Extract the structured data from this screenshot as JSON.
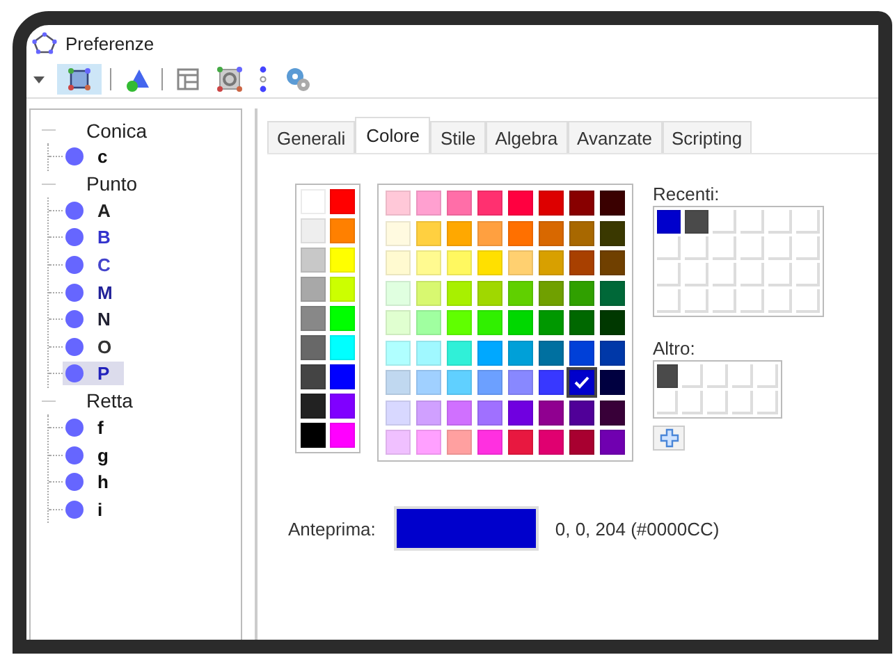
{
  "window": {
    "title": "Preferenze"
  },
  "toolbar": {
    "items": [
      {
        "kind": "dropdown",
        "selected": false
      },
      {
        "kind": "points",
        "selected": true
      },
      {
        "kind": "separator"
      },
      {
        "kind": "shapes",
        "selected": false
      },
      {
        "kind": "separator"
      },
      {
        "kind": "layout",
        "selected": false
      },
      {
        "kind": "graphics",
        "selected": false
      },
      {
        "kind": "dots",
        "selected": false
      },
      {
        "kind": "gears",
        "selected": false
      }
    ]
  },
  "tree": [
    {
      "label": "Conica",
      "expanded": true,
      "children": [
        {
          "label": "c",
          "color": "#111111",
          "selected": false
        }
      ]
    },
    {
      "label": "Punto",
      "expanded": true,
      "children": [
        {
          "label": "A",
          "color": "#222222",
          "selected": false
        },
        {
          "label": "B",
          "color": "#3333cc",
          "selected": false
        },
        {
          "label": "C",
          "color": "#4444cc",
          "selected": false
        },
        {
          "label": "M",
          "color": "#222299",
          "selected": false
        },
        {
          "label": "N",
          "color": "#222233",
          "selected": false
        },
        {
          "label": "O",
          "color": "#333333",
          "selected": false
        },
        {
          "label": "P",
          "color": "#2222bb",
          "selected": true
        }
      ]
    },
    {
      "label": "Retta",
      "expanded": true,
      "children": [
        {
          "label": "f",
          "color": "#111111",
          "selected": false
        },
        {
          "label": "g",
          "color": "#111111",
          "selected": false
        },
        {
          "label": "h",
          "color": "#111111",
          "selected": false
        },
        {
          "label": "i",
          "color": "#111111",
          "selected": false
        }
      ]
    }
  ],
  "tabs": [
    {
      "label": "Generali",
      "selected": false
    },
    {
      "label": "Colore",
      "selected": true
    },
    {
      "label": "Stile",
      "selected": false
    },
    {
      "label": "Algebra",
      "selected": false
    },
    {
      "label": "Avanzate",
      "selected": false
    },
    {
      "label": "Scripting",
      "selected": false
    }
  ],
  "gray_palette": [
    [
      {
        "color": "#ffffff",
        "selected": false
      },
      {
        "color": "#ff0000",
        "selected": false
      }
    ],
    [
      {
        "color": "#eeeeee",
        "selected": false
      },
      {
        "color": "#ff8000",
        "selected": false
      }
    ],
    [
      {
        "color": "#c8c8c8",
        "selected": false
      },
      {
        "color": "#ffff00",
        "selected": false
      }
    ],
    [
      {
        "color": "#a8a8a8",
        "selected": false
      },
      {
        "color": "#ccff00",
        "selected": false
      }
    ],
    [
      {
        "color": "#888888",
        "selected": false
      },
      {
        "color": "#00ff00",
        "selected": false
      }
    ],
    [
      {
        "color": "#686868",
        "selected": false
      },
      {
        "color": "#00ffff",
        "selected": false
      }
    ],
    [
      {
        "color": "#444444",
        "selected": false
      },
      {
        "color": "#0000ff",
        "selected": false
      }
    ],
    [
      {
        "color": "#222222",
        "selected": false
      },
      {
        "color": "#8000ff",
        "selected": false
      }
    ],
    [
      {
        "color": "#000000",
        "selected": false
      },
      {
        "color": "#ff00ff",
        "selected": false
      }
    ]
  ],
  "palette": [
    [
      {
        "color": "#ffc8d8",
        "selected": false
      },
      {
        "color": "#ffa0d0",
        "selected": false
      },
      {
        "color": "#ff6ea8",
        "selected": false
      },
      {
        "color": "#ff3070",
        "selected": false
      },
      {
        "color": "#ff0040",
        "selected": false
      },
      {
        "color": "#dd0000",
        "selected": false
      },
      {
        "color": "#880000",
        "selected": false
      },
      {
        "color": "#3a0000",
        "selected": false
      }
    ],
    [
      {
        "color": "#fffae0",
        "selected": false
      },
      {
        "color": "#ffd040",
        "selected": false
      },
      {
        "color": "#ffa800",
        "selected": false
      },
      {
        "color": "#ffa040",
        "selected": false
      },
      {
        "color": "#ff7000",
        "selected": false
      },
      {
        "color": "#d86800",
        "selected": false
      },
      {
        "color": "#a86800",
        "selected": false
      },
      {
        "color": "#3a3800",
        "selected": false
      }
    ],
    [
      {
        "color": "#fffad0",
        "selected": false
      },
      {
        "color": "#fffa90",
        "selected": false
      },
      {
        "color": "#fff860",
        "selected": false
      },
      {
        "color": "#ffe000",
        "selected": false
      },
      {
        "color": "#ffd070",
        "selected": false
      },
      {
        "color": "#d8a000",
        "selected": false
      },
      {
        "color": "#a84000",
        "selected": false
      },
      {
        "color": "#704000",
        "selected": false
      }
    ],
    [
      {
        "color": "#e0ffe0",
        "selected": false
      },
      {
        "color": "#d8f870",
        "selected": false
      },
      {
        "color": "#a8f000",
        "selected": false
      },
      {
        "color": "#a0d800",
        "selected": false
      },
      {
        "color": "#60d000",
        "selected": false
      },
      {
        "color": "#70a000",
        "selected": false
      },
      {
        "color": "#30a000",
        "selected": false
      },
      {
        "color": "#006838",
        "selected": false
      }
    ],
    [
      {
        "color": "#e0ffd0",
        "selected": false
      },
      {
        "color": "#a0ffa0",
        "selected": false
      },
      {
        "color": "#60ff00",
        "selected": false
      },
      {
        "color": "#30f000",
        "selected": false
      },
      {
        "color": "#00d800",
        "selected": false
      },
      {
        "color": "#009800",
        "selected": false
      },
      {
        "color": "#006800",
        "selected": false
      },
      {
        "color": "#003800",
        "selected": false
      }
    ],
    [
      {
        "color": "#b0ffff",
        "selected": false
      },
      {
        "color": "#a0f8ff",
        "selected": false
      },
      {
        "color": "#30f0d8",
        "selected": false
      },
      {
        "color": "#00a8ff",
        "selected": false
      },
      {
        "color": "#00a0d8",
        "selected": false
      },
      {
        "color": "#0070a0",
        "selected": false
      },
      {
        "color": "#0040d8",
        "selected": false
      },
      {
        "color": "#0038a8",
        "selected": false
      }
    ],
    [
      {
        "color": "#c0d8f0",
        "selected": false
      },
      {
        "color": "#a0d0ff",
        "selected": false
      },
      {
        "color": "#60d0ff",
        "selected": false
      },
      {
        "color": "#6ca0ff",
        "selected": false
      },
      {
        "color": "#8888ff",
        "selected": false
      },
      {
        "color": "#3838ff",
        "selected": false
      },
      {
        "color": "#0000cc",
        "selected": true
      },
      {
        "color": "#000040",
        "selected": false
      }
    ],
    [
      {
        "color": "#d8d8ff",
        "selected": false
      },
      {
        "color": "#d0a0ff",
        "selected": false
      },
      {
        "color": "#d070ff",
        "selected": false
      },
      {
        "color": "#a070ff",
        "selected": false
      },
      {
        "color": "#7000e0",
        "selected": false
      },
      {
        "color": "#900090",
        "selected": false
      },
      {
        "color": "#500098",
        "selected": false
      },
      {
        "color": "#380038",
        "selected": false
      }
    ],
    [
      {
        "color": "#f0c0ff",
        "selected": false
      },
      {
        "color": "#ffa0ff",
        "selected": false
      },
      {
        "color": "#ffa0a0",
        "selected": false
      },
      {
        "color": "#ff30e0",
        "selected": false
      },
      {
        "color": "#e81840",
        "selected": false
      },
      {
        "color": "#e00070",
        "selected": false
      },
      {
        "color": "#a80030",
        "selected": false
      },
      {
        "color": "#7000b0",
        "selected": false
      }
    ]
  ],
  "recent": {
    "label": "Recenti:",
    "colors": [
      {
        "color": "#0000cc"
      },
      {
        "color": "#4a4a4a"
      }
    ]
  },
  "other": {
    "label": "Altro:",
    "colors": [
      {
        "color": "#4a4a4a"
      }
    ]
  },
  "preview": {
    "label": "Anteprima:",
    "color": "#0000cc",
    "value": "0, 0, 204 (#0000CC)"
  }
}
